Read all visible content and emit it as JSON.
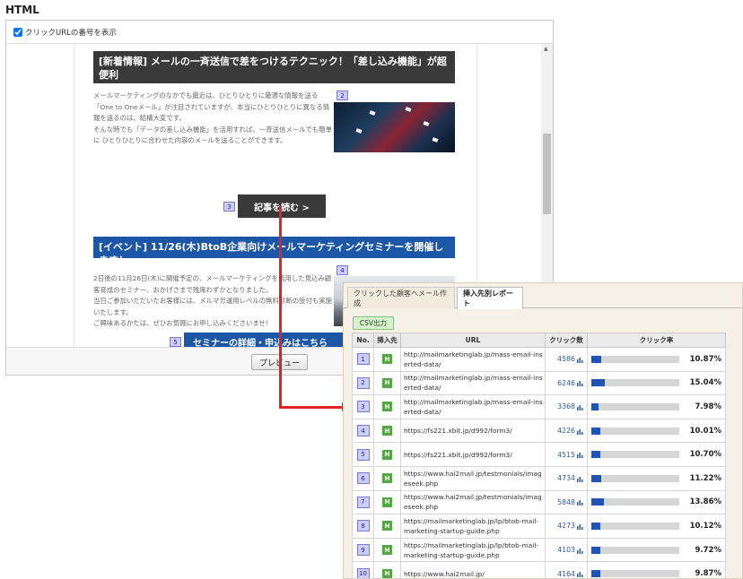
{
  "page": {
    "title": "HTML"
  },
  "editor": {
    "checkbox_label": "クリックURLの番号を表示",
    "checked": true,
    "preview_button": "プレビュー",
    "preview": {
      "article1": {
        "title": "[新着情報] メールの一斉送信で差をつけるテクニック！「差し込み機能」が超便利",
        "body": "メールマーケティングのなかでも最近は、ひとりひとりに最適な情報を送る「One to Oneメール」が注目されていますが、本当にひとりひとりに異なる情報を送るのは、結構大変です。\nそんな時でも「データの差し込み機能」を活用すれば、一斉送信メールでも簡単に ひとりひとりに合わせた内容のメールを送ることができます。",
        "image_badge": "2"
      },
      "cta": {
        "label": "記事を読む >",
        "badge": "3"
      },
      "article2": {
        "title": "[イベント] 11/26(木)BtoB企業向けメールマーケティングセミナーを開催します！",
        "body": "2日後の11月26日(木)に開催予定の、メールマーケティングを活用した見込み顧客育成のセミナー、おかげさまで残席わずかとなりました。\n当日ご参加いただいたお客様には、メルマガ運用レベルの無料診断の受付も実施いたします。\nご興味あるかたは、ぜひお気軽にお申し込みくださいませ！",
        "image_badge": "4"
      },
      "cta2": {
        "label": "セミナーの詳細・申込みはこちら",
        "badge": "5"
      }
    }
  },
  "report": {
    "tabs": [
      "クリックした顧客へメール作成",
      "挿入先別レポート"
    ],
    "active_tab": 1,
    "csv_button": "CSV出力",
    "columns": [
      "No.",
      "挿入先",
      "URL",
      "クリック数",
      "クリック率"
    ],
    "insert_icon": "H",
    "bar_color": "#1c55b5",
    "rows": [
      {
        "no": "1",
        "url": "http://mailmarketinglab.jp/mass-email-inserted-data/",
        "clicks": "4586",
        "rate": "10.87%",
        "rate_value": 0.1087
      },
      {
        "no": "2",
        "url": "http://mailmarketinglab.jp/mass-email-inserted-data/",
        "clicks": "6246",
        "rate": "15.04%",
        "rate_value": 0.1504
      },
      {
        "no": "3",
        "url": "http://mailmarketinglab.jp/mass-email-inserted-data/",
        "clicks": "3368",
        "rate": "7.98%",
        "rate_value": 0.0798
      },
      {
        "no": "4",
        "url": "https://fs221.xbit.jp/d992/form3/",
        "clicks": "4226",
        "rate": "10.01%",
        "rate_value": 0.1001
      },
      {
        "no": "5",
        "url": "https://fs221.xbit.jp/d992/form3/",
        "clicks": "4515",
        "rate": "10.70%",
        "rate_value": 0.107
      },
      {
        "no": "6",
        "url": "https://www.hai2mail.jp/testmonials/imageseek.php",
        "clicks": "4734",
        "rate": "11.22%",
        "rate_value": 0.1122
      },
      {
        "no": "7",
        "url": "https://www.hai2mail.jp/testmonials/imageseek.php",
        "clicks": "5848",
        "rate": "13.86%",
        "rate_value": 0.1386
      },
      {
        "no": "8",
        "url": "https://mailmarketinglab.jp/lp/btob-mail-marketing-startup-guide.php",
        "clicks": "4273",
        "rate": "10.12%",
        "rate_value": 0.1012
      },
      {
        "no": "9",
        "url": "https://mailmarketinglab.jp/lp/btob-mail-marketing-startup-guide.php",
        "clicks": "4103",
        "rate": "9.72%",
        "rate_value": 0.0972
      },
      {
        "no": "10",
        "url": "https://www.hai2mail.jp/",
        "clicks": "4164",
        "rate": "9.87%",
        "rate_value": 0.0987
      }
    ]
  }
}
